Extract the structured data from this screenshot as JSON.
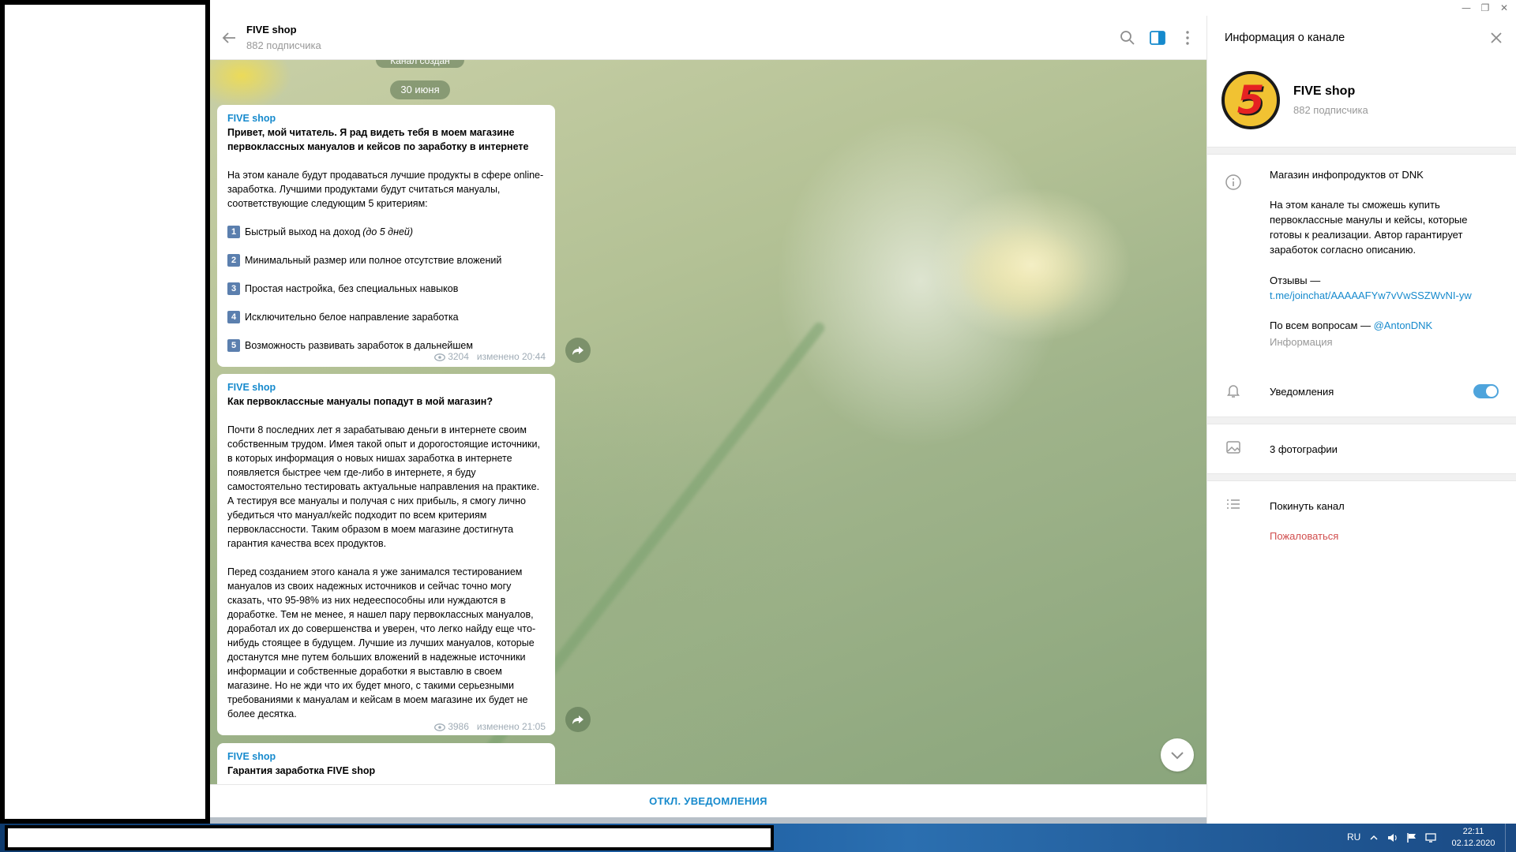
{
  "window": {
    "minimize": "—",
    "maximize": "❐",
    "close": "✕"
  },
  "chat_header": {
    "title": "FIVE shop",
    "subtitle": "882 подписчика"
  },
  "chat": {
    "date_top": "Канал создан",
    "date": "30 июня",
    "messages": [
      {
        "sender": "FIVE shop",
        "headline": "Привет, мой читатель. Я рад видеть тебя в моем магазине первоклассных мануалов и кейсов по заработку в интернете",
        "intro": "На этом канале будут продаваться лучшие продукты в сфере online-заработка. Лучшими продуктами будут считаться мануалы, соответствующие следующим 5 критериям:",
        "items": [
          {
            "num": "1",
            "text": "Быстрый выход на доход ",
            "em": "(до 5 дней)"
          },
          {
            "num": "2",
            "text": "Минимальный размер или полное отсутствие вложений",
            "em": ""
          },
          {
            "num": "3",
            "text": "Простая настройка, без специальных навыков",
            "em": ""
          },
          {
            "num": "4",
            "text": "Исключительно белое направление заработка",
            "em": ""
          },
          {
            "num": "5",
            "text": "Возможность развивать заработок в дальнейшем",
            "em": ""
          }
        ],
        "views": "3204",
        "edited": "изменено 20:44"
      },
      {
        "sender": "FIVE shop",
        "headline": "Как первоклассные мануалы попадут в мой магазин?",
        "para1": "Почти 8 последних лет я зарабатываю деньги в интернете своим собственным трудом. Имея такой опыт и дорогостоящие источники, в которых информация о новых нишах заработка в интернете появляется быстрее чем где-либо в интернете, я буду самостоятельно тестировать актуальные направления на практике. А тестируя все мануалы и получая с них прибыль, я смогу лично убедиться что мануал/кейс подходит по всем критериям первоклассности. Таким образом в моем магазине достигнута гарантия качества всех продуктов.",
        "para2": "Перед созданием этого канала я уже занимался тестированием мануалов из своих надежных источников и сейчас точно могу сказать, что 95-98% из них недееспособны или нуждаются в доработке. Тем не менее, я нашел пару первоклассных мануалов, доработал их до совершенства и уверен, что легко найду еще что-нибудь стоящее в будущем. Лучшие из лучших мануалов, которые достанутся мне путем больших вложений в надежные источники информации и собственные доработки я выставлю в своем магазине. Но не жди что их будет много, с такими серьезными требованиями к мануалам и кейсам в моем магазине их будет не более десятка.",
        "views": "3986",
        "edited": "изменено 21:05"
      },
      {
        "sender": "FIVE shop",
        "headline": "Гарантия заработка FIVE shop"
      }
    ]
  },
  "mute_button": "ОТКЛ. УВЕДОМЛЕНИЯ",
  "info_panel": {
    "title": "Информация о канале",
    "avatar_letter": "5",
    "channel_name": "FIVE shop",
    "subscribers": "882 подписчика",
    "description_title": "Магазин инфопродуктов от DNK",
    "description_body": "На этом канале ты сможешь купить первоклассные манулы и кейсы, которые готовы к реализации. Автор гарантирует заработок согласно описанию.",
    "reviews_label": "Отзывы —",
    "reviews_link": "t.me/joinchat/AAAAAFYw7vVwSSZWvNI-yw",
    "questions_label": "По всем вопросам — ",
    "questions_link": "@AntonDNK",
    "info_caption": "Информация",
    "notifications_label": "Уведомления",
    "notifications_on": true,
    "photos_label": "3 фотографии",
    "leave_label": "Покинуть канал",
    "report_label": "Пожаловаться"
  },
  "taskbar": {
    "lang": "RU",
    "time": "22:11",
    "date": "02.12.2020"
  },
  "colors": {
    "accent": "#168acd",
    "toggle": "#4ea4dc",
    "danger": "#d14e4e",
    "taskbar": "#1a5a9e"
  }
}
